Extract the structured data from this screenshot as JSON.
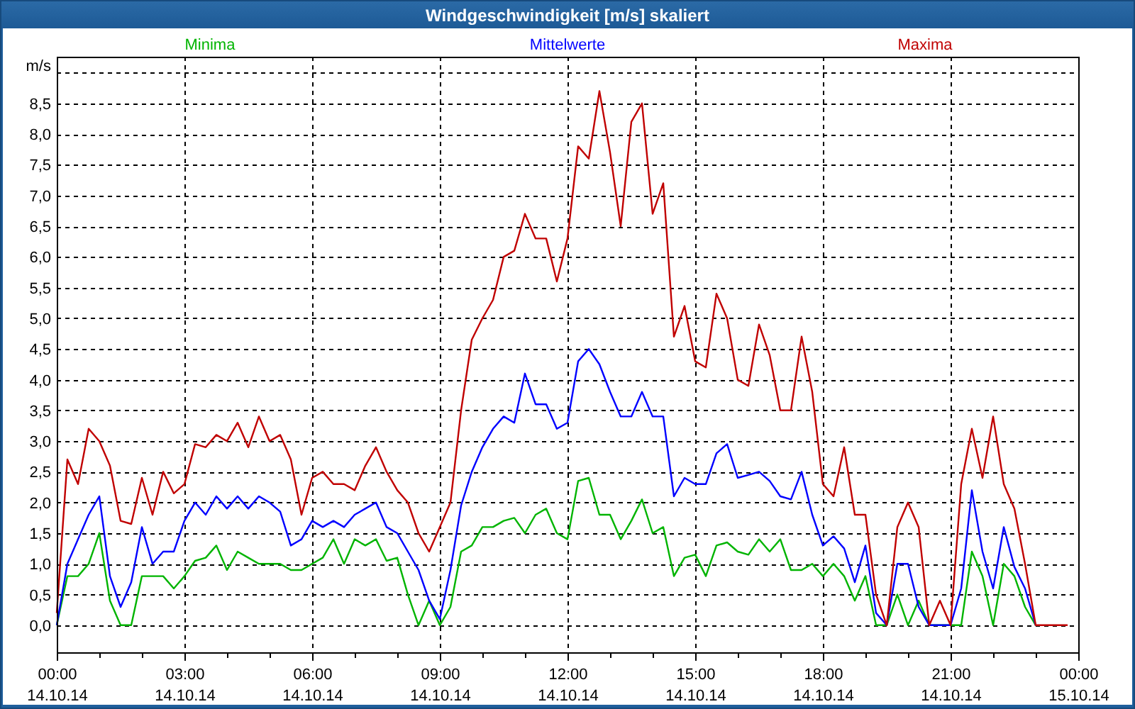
{
  "window": {
    "title": "Windgeschwindigkeit [m/s] skaliert"
  },
  "chart": {
    "chart_data": {
      "type": "line",
      "ylabel": "m/s",
      "xlim": [
        0,
        24
      ],
      "ylim": [
        -0.44,
        9.26
      ],
      "grid": true,
      "xticks": [
        {
          "value": 0,
          "label": "00:00"
        },
        {
          "value": 3,
          "label": "03:00"
        },
        {
          "value": 6,
          "label": "06:00"
        },
        {
          "value": 9,
          "label": "09:00"
        },
        {
          "value": 12,
          "label": "12:00"
        },
        {
          "value": 15,
          "label": "15:00"
        },
        {
          "value": 18,
          "label": "18:00"
        },
        {
          "value": 21,
          "label": "21:00"
        },
        {
          "value": 24,
          "label": "00:00"
        }
      ],
      "yticks": [
        {
          "value": 0,
          "label": "0,0"
        },
        {
          "value": 0.5,
          "label": "0,5"
        },
        {
          "value": 1,
          "label": "1,0"
        },
        {
          "value": 1.5,
          "label": "1,5"
        },
        {
          "value": 2,
          "label": "2,0"
        },
        {
          "value": 2.5,
          "label": "2,5"
        },
        {
          "value": 3,
          "label": "3,0"
        },
        {
          "value": 3.5,
          "label": "3,5"
        },
        {
          "value": 4,
          "label": "4,0"
        },
        {
          "value": 4.5,
          "label": "4,5"
        },
        {
          "value": 5,
          "label": "5,0"
        },
        {
          "value": 5.5,
          "label": "5,5"
        },
        {
          "value": 6,
          "label": "6,0"
        },
        {
          "value": 6.5,
          "label": "6,5"
        },
        {
          "value": 7,
          "label": "7,0"
        },
        {
          "value": 7.5,
          "label": "7,5"
        },
        {
          "value": 8,
          "label": "8,0"
        },
        {
          "value": 8.5,
          "label": "8,5"
        }
      ],
      "x": [
        0,
        0.25,
        0.5,
        0.75,
        1,
        1.25,
        1.5,
        1.75,
        2,
        2.25,
        2.5,
        2.75,
        3,
        3.25,
        3.5,
        3.75,
        4,
        4.25,
        4.5,
        4.75,
        5,
        5.25,
        5.5,
        5.75,
        6,
        6.25,
        6.5,
        6.75,
        7,
        7.25,
        7.5,
        7.75,
        8,
        8.25,
        8.5,
        8.75,
        9,
        9.25,
        9.5,
        9.75,
        10,
        10.25,
        10.5,
        10.75,
        11,
        11.25,
        11.5,
        11.75,
        12,
        12.25,
        12.5,
        12.75,
        13,
        13.25,
        13.5,
        13.75,
        14,
        14.25,
        14.5,
        14.75,
        15,
        15.25,
        15.5,
        15.75,
        16,
        16.25,
        16.5,
        16.75,
        17,
        17.25,
        17.5,
        17.75,
        18,
        18.25,
        18.5,
        18.75,
        19,
        19.25,
        19.5,
        19.75,
        20,
        20.25,
        20.5,
        20.75,
        21,
        21.25,
        21.5,
        21.75,
        22,
        22.25,
        22.5,
        22.75,
        23,
        23.25,
        23.5,
        23.75
      ],
      "series": [
        {
          "name": "Minima",
          "color": "#00b400",
          "values": [
            0,
            0.8,
            0.8,
            1.0,
            1.5,
            0.4,
            0,
            0,
            0.8,
            0.8,
            0.8,
            0.6,
            0.8,
            1.05,
            1.1,
            1.3,
            0.9,
            1.2,
            1.1,
            1.0,
            1.0,
            1.0,
            0.9,
            0.9,
            1.0,
            1.1,
            1.4,
            1.0,
            1.4,
            1.3,
            1.4,
            1.05,
            1.1,
            0.5,
            0,
            0.4,
            0,
            0.3,
            1.2,
            1.3,
            1.6,
            1.6,
            1.7,
            1.75,
            1.5,
            1.8,
            1.9,
            1.5,
            1.4,
            2.35,
            2.4,
            1.8,
            1.8,
            1.4,
            1.7,
            2.05,
            1.5,
            1.6,
            0.8,
            1.1,
            1.15,
            0.8,
            1.3,
            1.35,
            1.2,
            1.15,
            1.4,
            1.2,
            1.4,
            0.9,
            0.9,
            1.0,
            0.8,
            1.0,
            0.8,
            0.4,
            0.8,
            0,
            0,
            0.5,
            0,
            0.4,
            0,
            0,
            0,
            0,
            1.2,
            0.8,
            0,
            1.0,
            0.8,
            0.3,
            0,
            null,
            null,
            null
          ]
        },
        {
          "name": "Mittelwerte",
          "color": "#0000ff",
          "values": [
            0,
            1.0,
            1.4,
            1.8,
            2.1,
            0.8,
            0.3,
            0.7,
            1.6,
            1.0,
            1.2,
            1.2,
            1.7,
            2.0,
            1.8,
            2.1,
            1.9,
            2.1,
            1.9,
            2.1,
            2.0,
            1.85,
            1.3,
            1.4,
            1.7,
            1.6,
            1.7,
            1.6,
            1.8,
            1.9,
            2.0,
            1.6,
            1.5,
            1.2,
            0.9,
            0.4,
            0.1,
            0.9,
            1.95,
            2.5,
            2.9,
            3.2,
            3.4,
            3.3,
            4.1,
            3.6,
            3.6,
            3.2,
            3.3,
            4.3,
            4.5,
            4.25,
            3.8,
            3.4,
            3.4,
            3.8,
            3.4,
            3.4,
            2.1,
            2.4,
            2.3,
            2.3,
            2.8,
            2.95,
            2.4,
            2.45,
            2.5,
            2.35,
            2.1,
            2.05,
            2.5,
            1.8,
            1.3,
            1.45,
            1.25,
            0.7,
            1.3,
            0.2,
            0,
            1.0,
            1.0,
            0.3,
            0,
            0,
            0,
            0.6,
            2.2,
            1.2,
            0.6,
            1.6,
            0.95,
            0.6,
            0,
            null,
            null,
            null
          ]
        },
        {
          "name": "Maxima",
          "color": "#c00000",
          "values": [
            0.2,
            2.7,
            2.3,
            3.2,
            3.0,
            2.6,
            1.7,
            1.65,
            2.4,
            1.8,
            2.5,
            2.15,
            2.3,
            2.95,
            2.9,
            3.1,
            3.0,
            3.3,
            2.9,
            3.4,
            3.0,
            3.1,
            2.7,
            1.8,
            2.4,
            2.5,
            2.3,
            2.3,
            2.2,
            2.6,
            2.9,
            2.5,
            2.2,
            2.0,
            1.5,
            1.2,
            1.6,
            2.0,
            3.5,
            4.65,
            5.0,
            5.3,
            6.0,
            6.1,
            6.7,
            6.3,
            6.3,
            5.6,
            6.3,
            7.8,
            7.6,
            8.7,
            7.7,
            6.5,
            8.2,
            8.5,
            6.7,
            7.2,
            4.7,
            5.2,
            4.3,
            4.2,
            5.4,
            5.0,
            4.0,
            3.9,
            4.9,
            4.4,
            3.5,
            3.5,
            4.7,
            3.8,
            2.3,
            2.1,
            2.9,
            1.8,
            1.8,
            0.5,
            0,
            1.6,
            2.0,
            1.6,
            0,
            0.4,
            0,
            2.3,
            3.2,
            2.4,
            3.4,
            2.3,
            1.9,
            1.0,
            0,
            0,
            0,
            0
          ]
        }
      ]
    },
    "date_labels": [
      "14.10.14",
      "14.10.14",
      "14.10.14",
      "14.10.14",
      "14.10.14",
      "14.10.14",
      "14.10.14",
      "14.10.14",
      "15.10.14"
    ]
  }
}
